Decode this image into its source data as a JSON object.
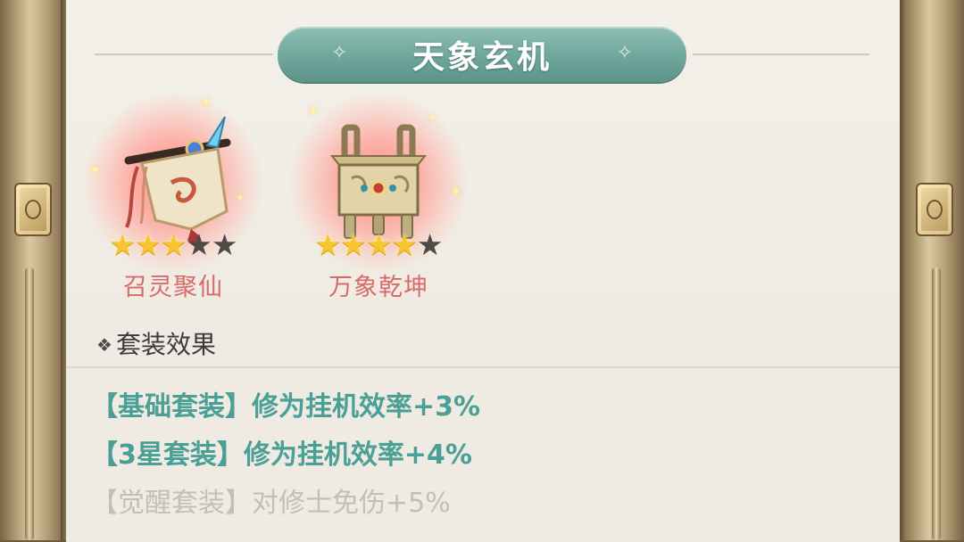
{
  "title": "天象玄机",
  "items": [
    {
      "name": "召灵聚仙",
      "stars_filled": 3,
      "stars_total": 5
    },
    {
      "name": "万象乾坤",
      "stars_filled": 4,
      "stars_total": 5
    }
  ],
  "section_title": "套装效果",
  "effects": [
    {
      "tag": "【基础套装】",
      "text": "修为挂机效率+3%",
      "active": true
    },
    {
      "tag": "【3星套装】",
      "text": "修为挂机效率+4%",
      "active": true
    },
    {
      "tag": "【觉醒套装】",
      "text": "对修士免伤+5%",
      "active": false
    }
  ],
  "colors": {
    "banner": "#6fa69b",
    "active_effect": "#4aa096",
    "inactive_effect": "#c3bfb8",
    "item_name": "#d86a6a",
    "star_on": "#f7c62f",
    "star_off": "#4d4a47"
  }
}
